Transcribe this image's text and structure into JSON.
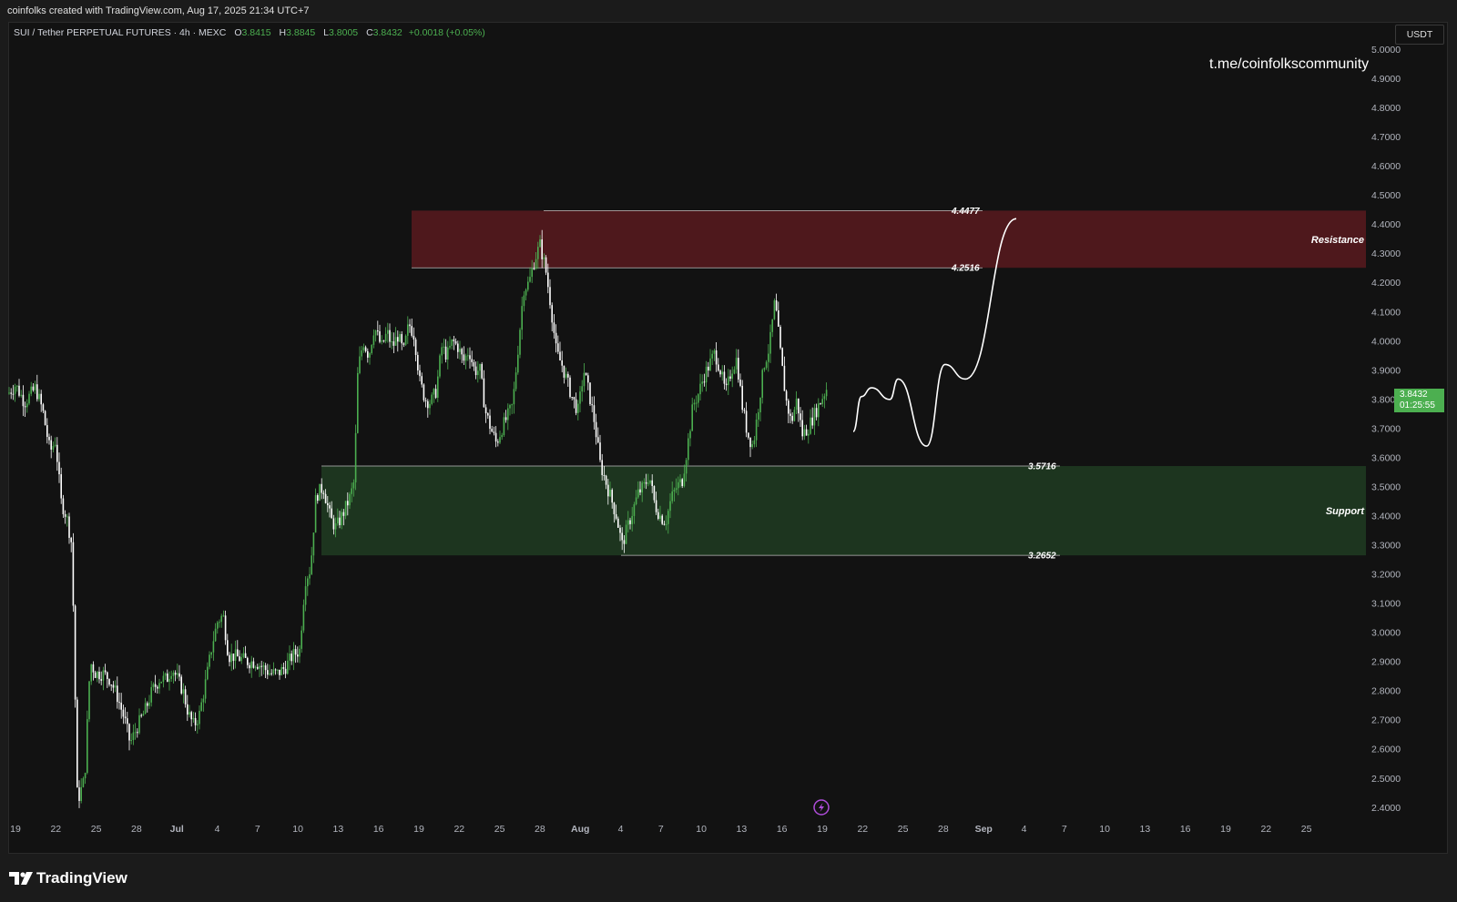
{
  "header": {
    "attribution": "coinfolks created with TradingView.com, Aug 17, 2025 21:34 UTC+7"
  },
  "legend": {
    "symbol": "SUI / Tether PERPETUAL FUTURES · 4h · MEXC",
    "open_label": "O",
    "open": "3.8415",
    "high_label": "H",
    "high": "3.8845",
    "low_label": "L",
    "low": "3.8005",
    "close_label": "C",
    "close": "3.8432",
    "change": "+0.0018 (+0.05%)"
  },
  "currency_button": "USDT",
  "watermark": "t.me/coinfolkscommunity",
  "price_tag": {
    "price": "3.8432",
    "countdown": "01:25:55"
  },
  "footer": {
    "brand": "TradingView"
  },
  "colors": {
    "background": "#121212",
    "up": "#4caf50",
    "down": "#ffffff",
    "resistance": "#7f1d25",
    "support": "#244d28",
    "accent": "#b04ddb"
  },
  "icons": {
    "lightning": "lightning-icon",
    "logo": "tradingview-logo-icon"
  },
  "chart_data": {
    "type": "candlestick",
    "timeframe": "4h",
    "x_ticks": [
      "19",
      "22",
      "25",
      "28",
      "Jul",
      "4",
      "7",
      "10",
      "13",
      "16",
      "19",
      "22",
      "25",
      "28",
      "Aug",
      "4",
      "7",
      "10",
      "13",
      "16",
      "19",
      "22",
      "25",
      "28",
      "Sep",
      "4",
      "7",
      "10",
      "13",
      "16",
      "19",
      "22",
      "25"
    ],
    "y_ticks": [
      "5.0000",
      "4.9000",
      "4.8000",
      "4.7000",
      "4.6000",
      "4.5000",
      "4.4000",
      "4.3000",
      "4.2000",
      "4.1000",
      "4.0000",
      "3.9000",
      "3.8000",
      "3.7000",
      "3.6000",
      "3.5000",
      "3.4000",
      "3.3000",
      "3.2000",
      "3.1000",
      "3.0000",
      "2.9000",
      "2.8000",
      "2.7000",
      "2.6000",
      "2.5000",
      "2.4000"
    ],
    "ylim": [
      2.37,
      5.03
    ],
    "price_path": [
      [
        0,
        3.82
      ],
      [
        8,
        3.85
      ],
      [
        18,
        3.79
      ],
      [
        30,
        3.84
      ],
      [
        38,
        3.76
      ],
      [
        46,
        3.62
      ],
      [
        52,
        3.66
      ],
      [
        58,
        3.45
      ],
      [
        64,
        3.4
      ],
      [
        70,
        3.3
      ],
      [
        76,
        2.42
      ],
      [
        84,
        2.5
      ],
      [
        90,
        2.9
      ],
      [
        96,
        2.86
      ],
      [
        104,
        2.86
      ],
      [
        112,
        2.84
      ],
      [
        120,
        2.78
      ],
      [
        128,
        2.7
      ],
      [
        134,
        2.62
      ],
      [
        142,
        2.68
      ],
      [
        150,
        2.73
      ],
      [
        158,
        2.8
      ],
      [
        166,
        2.84
      ],
      [
        174,
        2.84
      ],
      [
        180,
        2.88
      ],
      [
        186,
        2.84
      ],
      [
        192,
        2.8
      ],
      [
        198,
        2.72
      ],
      [
        204,
        2.68
      ],
      [
        210,
        2.72
      ],
      [
        218,
        2.85
      ],
      [
        224,
        2.96
      ],
      [
        230,
        3.04
      ],
      [
        236,
        3.06
      ],
      [
        242,
        2.92
      ],
      [
        248,
        2.92
      ],
      [
        256,
        2.91
      ],
      [
        264,
        2.9
      ],
      [
        272,
        2.9
      ],
      [
        280,
        2.88
      ],
      [
        288,
        2.86
      ],
      [
        296,
        2.86
      ],
      [
        304,
        2.88
      ],
      [
        312,
        2.92
      ],
      [
        320,
        2.94
      ],
      [
        326,
        3.18
      ],
      [
        332,
        3.22
      ],
      [
        338,
        3.47
      ],
      [
        346,
        3.5
      ],
      [
        354,
        3.39
      ],
      [
        360,
        3.36
      ],
      [
        368,
        3.41
      ],
      [
        376,
        3.47
      ],
      [
        380,
        3.52
      ],
      [
        384,
        3.9
      ],
      [
        390,
        4.0
      ],
      [
        396,
        3.95
      ],
      [
        402,
        4.05
      ],
      [
        410,
        3.98
      ],
      [
        416,
        4.03
      ],
      [
        422,
        3.98
      ],
      [
        428,
        4.02
      ],
      [
        434,
        3.96
      ],
      [
        440,
        4.06
      ],
      [
        446,
        4.02
      ],
      [
        452,
        3.86
      ],
      [
        458,
        3.8
      ],
      [
        464,
        3.79
      ],
      [
        470,
        3.83
      ],
      [
        476,
        3.98
      ],
      [
        482,
        3.95
      ],
      [
        488,
        4.0
      ],
      [
        494,
        3.98
      ],
      [
        500,
        3.93
      ],
      [
        506,
        3.97
      ],
      [
        512,
        3.9
      ],
      [
        518,
        3.9
      ],
      [
        524,
        3.76
      ],
      [
        530,
        3.7
      ],
      [
        536,
        3.65
      ],
      [
        542,
        3.7
      ],
      [
        548,
        3.74
      ],
      [
        554,
        3.78
      ],
      [
        560,
        3.98
      ],
      [
        566,
        4.18
      ],
      [
        572,
        4.2
      ],
      [
        578,
        4.28
      ],
      [
        584,
        4.33
      ],
      [
        590,
        4.25
      ],
      [
        596,
        4.12
      ],
      [
        602,
        3.96
      ],
      [
        608,
        3.92
      ],
      [
        614,
        3.86
      ],
      [
        620,
        3.8
      ],
      [
        626,
        3.76
      ],
      [
        632,
        3.9
      ],
      [
        638,
        3.82
      ],
      [
        644,
        3.72
      ],
      [
        650,
        3.58
      ],
      [
        656,
        3.52
      ],
      [
        662,
        3.46
      ],
      [
        668,
        3.4
      ],
      [
        674,
        3.3
      ],
      [
        680,
        3.36
      ],
      [
        686,
        3.42
      ],
      [
        692,
        3.48
      ],
      [
        698,
        3.5
      ],
      [
        704,
        3.54
      ],
      [
        710,
        3.44
      ],
      [
        716,
        3.4
      ],
      [
        722,
        3.38
      ],
      [
        728,
        3.46
      ],
      [
        734,
        3.5
      ],
      [
        740,
        3.52
      ],
      [
        746,
        3.64
      ],
      [
        752,
        3.78
      ],
      [
        758,
        3.82
      ],
      [
        764,
        3.88
      ],
      [
        770,
        3.92
      ],
      [
        776,
        3.96
      ],
      [
        782,
        3.9
      ],
      [
        788,
        3.82
      ],
      [
        794,
        3.9
      ],
      [
        800,
        3.94
      ],
      [
        806,
        3.78
      ],
      [
        812,
        3.68
      ],
      [
        818,
        3.64
      ],
      [
        824,
        3.78
      ],
      [
        830,
        3.92
      ],
      [
        836,
        3.98
      ],
      [
        842,
        4.14
      ],
      [
        848,
        3.96
      ],
      [
        854,
        3.8
      ],
      [
        860,
        3.72
      ],
      [
        866,
        3.8
      ],
      [
        872,
        3.68
      ],
      [
        878,
        3.7
      ],
      [
        884,
        3.74
      ],
      [
        890,
        3.78
      ],
      [
        896,
        3.82
      ],
      [
        899,
        3.84
      ]
    ],
    "projection_path": [
      [
        3.69,
        0
      ],
      [
        3.81,
        0.04
      ],
      [
        3.84,
        0.09
      ],
      [
        3.8,
        0.18
      ],
      [
        3.87,
        0.22
      ],
      [
        3.64,
        0.36
      ],
      [
        3.92,
        0.45
      ],
      [
        3.87,
        0.55
      ],
      [
        4.42,
        0.8
      ]
    ],
    "zones": [
      {
        "name": "Resistance",
        "top": 4.4477,
        "bottom": 4.2516,
        "top_label": "4.4477",
        "bottom_label": "4.2516"
      },
      {
        "name": "Support",
        "top": 3.5716,
        "bottom": 3.2652,
        "top_label": "3.5716",
        "bottom_label": "3.2652"
      }
    ]
  }
}
